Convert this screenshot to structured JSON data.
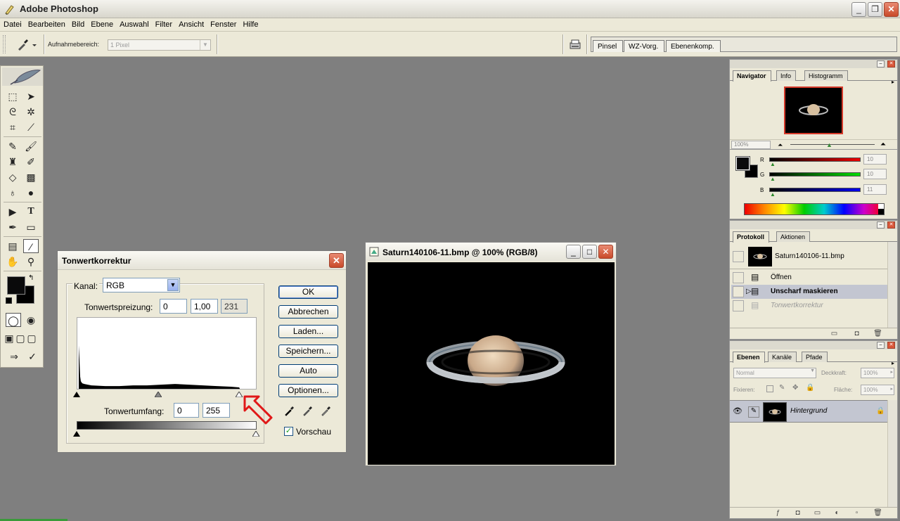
{
  "app": {
    "title": "Adobe Photoshop"
  },
  "window_controls": {
    "minimize": "_",
    "restore": "❐",
    "close": "✕"
  },
  "menu": [
    "Datei",
    "Bearbeiten",
    "Bild",
    "Ebene",
    "Auswahl",
    "Filter",
    "Ansicht",
    "Fenster",
    "Hilfe"
  ],
  "options": {
    "sample_label": "Aufnahmebereich:",
    "sample_value": "1 Pixel",
    "well_tabs": [
      "Pinsel",
      "WZ-Vorg.",
      "Ebenenkomp."
    ]
  },
  "dialog": {
    "title": "Tonwertkorrektur",
    "close": "✕",
    "channel_label": "Kanal:",
    "channel_value": "RGB",
    "input_levels_label": "Tonwertspreizung:",
    "input_black": "0",
    "input_gamma": "1,00",
    "input_white": "231",
    "output_levels_label": "Tonwertumfang:",
    "output_black": "0",
    "output_white": "255",
    "buttons": {
      "ok": "OK",
      "cancel": "Abbrechen",
      "load": "Laden...",
      "save": "Speichern...",
      "auto": "Auto",
      "options": "Optionen..."
    },
    "preview_label": "Vorschau",
    "preview_checked": true
  },
  "image_window": {
    "title": "Saturn140106-11.bmp @ 100% (RGB/8)",
    "min": "_",
    "max": "□",
    "close": "✕"
  },
  "navigator": {
    "tabs": [
      "Navigator",
      "Info",
      "Histogramm"
    ],
    "zoom": "100%",
    "menu": "▸"
  },
  "color": {
    "r_label": "R",
    "g_label": "G",
    "b_label": "B",
    "r_value": "10",
    "g_value": "10",
    "b_value": "11",
    "fg_color": "#0a0a0b",
    "bg_color": "#000000"
  },
  "history": {
    "tabs": [
      "Protokoll",
      "Aktionen"
    ],
    "snapshot": "Saturn140106-11.bmp",
    "items": [
      {
        "label": "Öffnen",
        "state": "normal"
      },
      {
        "label": "Unscharf maskieren",
        "state": "active"
      },
      {
        "label": "Tonwertkorrektur",
        "state": "undone"
      }
    ]
  },
  "layers": {
    "tabs": [
      "Ebenen",
      "Kanäle",
      "Pfade"
    ],
    "blend_mode": "Normal",
    "opacity_label": "Deckkraft:",
    "opacity_value": "100%",
    "lock_label": "Fixieren:",
    "fill_label": "Fläche:",
    "fill_value": "100%",
    "layer_name": "Hintergrund"
  },
  "colors": {
    "dialog_arrow": "#e01818",
    "accent_blue": "#003c74"
  }
}
